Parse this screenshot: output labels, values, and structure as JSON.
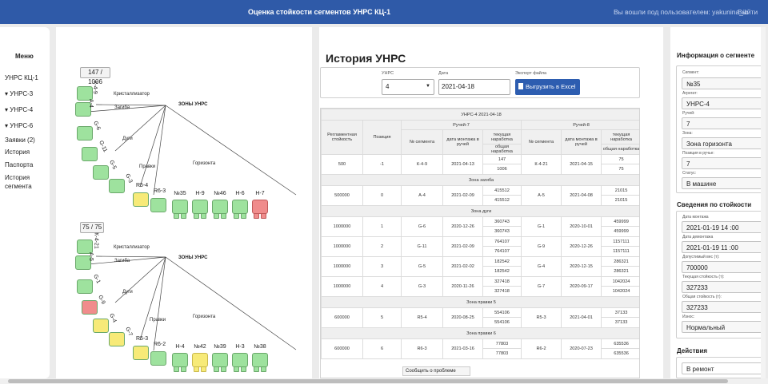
{
  "header": {
    "title": "Оценка стойкости сегментов УНРС КЦ-1",
    "user": "Вы вошли под пользователем: yakunina_ib",
    "logout": "Выйти"
  },
  "menu": {
    "title": "Меню",
    "items": [
      "УНРС КЦ-1",
      "▾ УНРС-3",
      "▾ УНРС-4",
      "▾ УНРС-6",
      "Заявки (2)",
      "История",
      "Паспорта",
      "История",
      "сегмента"
    ]
  },
  "diagram": {
    "top": {
      "counter": "147 / 1006",
      "labels": {
        "crystal": "Кристаллизатор",
        "bend": "Загиба",
        "zones": "ЗОНЫ УНРС",
        "arcs": "Дуги",
        "straight": "Правки",
        "horizon": "Горизонта"
      },
      "arc_segments": [
        {
          "name": "К-4-9",
          "status": "green"
        },
        {
          "name": "А-4",
          "status": "green"
        },
        {
          "name": "G-6",
          "status": "green"
        },
        {
          "name": "G-11",
          "status": "green"
        },
        {
          "name": "G-5",
          "status": "green"
        },
        {
          "name": "G-3",
          "status": "green"
        },
        {
          "name": "R5-4",
          "status": "yellow"
        },
        {
          "name": "R6-3",
          "status": "green"
        }
      ],
      "row_segments": [
        {
          "name": "№35",
          "status": "green"
        },
        {
          "name": "Н-9",
          "status": "green"
        },
        {
          "name": "№46",
          "status": "green"
        },
        {
          "name": "Н-6",
          "status": "green"
        },
        {
          "name": "Н-7",
          "status": "red"
        }
      ]
    },
    "bottom": {
      "counter": "75 / 75",
      "labels": {
        "crystal": "Кристаллизатор",
        "bend": "Загиба",
        "zones": "ЗОНЫ УНРС",
        "arcs": "Дуги",
        "straight": "Правки",
        "horizon": "Горизонта"
      },
      "arc_segments": [
        {
          "name": "К-4-21",
          "status": "green"
        },
        {
          "name": "А-5",
          "status": "green"
        },
        {
          "name": "G-1",
          "status": "green"
        },
        {
          "name": "G-9",
          "status": "red"
        },
        {
          "name": "G-4",
          "status": "yellow"
        },
        {
          "name": "G-7",
          "status": "yellow"
        },
        {
          "name": "R5-3",
          "status": "yellow"
        },
        {
          "name": "R6-2",
          "status": "green"
        }
      ],
      "row_segments": [
        {
          "name": "Н-4",
          "status": "green"
        },
        {
          "name": "№42",
          "status": "yellow"
        },
        {
          "name": "№39",
          "status": "green"
        },
        {
          "name": "Н-3",
          "status": "green"
        },
        {
          "name": "№38",
          "status": "green"
        }
      ]
    }
  },
  "main": {
    "title": "История УНРС",
    "filters": {
      "unrs_label": "УНРС",
      "unrs_value": "4",
      "date_label": "Дата",
      "date_value": "2021-04-18",
      "export_label": "Экспорт файла",
      "export_button": "Выгрузить в Excel"
    },
    "table": {
      "caption": "УНРС-4 2021-04-18",
      "headers": {
        "resist": "Регламентная стойкость",
        "position": "Позиция",
        "ruchey7": "Ручей-7",
        "ruchey8": "Ручей-8",
        "seg": "№ сегмента",
        "date": "дата монтажа в ручей",
        "cur": "текущая наработка",
        "total": "общая наработка"
      },
      "rows": [
        {
          "type": "data",
          "resist": "500",
          "pos": "-1",
          "s7": "К-4-9",
          "d7": "2021-04-13",
          "c7": "147",
          "t7": "1006",
          "s8": "К-4-21",
          "d8": "2021-04-15",
          "c8": "75",
          "t8": "75"
        },
        {
          "type": "zone",
          "label": "Зона загиба"
        },
        {
          "type": "data",
          "resist": "500000",
          "pos": "0",
          "s7": "А-4",
          "d7": "2021-02-09",
          "c7": "415512",
          "t7": "415512",
          "s8": "А-5",
          "d8": "2021-04-08",
          "c8": "21015",
          "t8": "21015"
        },
        {
          "type": "zone",
          "label": "Зона дуги"
        },
        {
          "type": "data",
          "resist": "1000000",
          "pos": "1",
          "s7": "G-6",
          "d7": "2020-12-26",
          "c7": "360743",
          "t7": "360743",
          "s8": "G-1",
          "d8": "2020-10-01",
          "c8": "459999",
          "t8": "459999"
        },
        {
          "type": "data",
          "resist": "1000000",
          "pos": "2",
          "s7": "G-11",
          "d7": "2021-02-09",
          "c7": "764107",
          "t7": "764107",
          "s8": "G-9",
          "d8": "2020-12-26",
          "c8": "1157111",
          "t8": "1157111"
        },
        {
          "type": "data",
          "resist": "1000000",
          "pos": "3",
          "s7": "G-5",
          "d7": "2021-02-02",
          "c7": "182542",
          "t7": "182542",
          "s8": "G-4",
          "d8": "2020-12-15",
          "c8": "286321",
          "t8": "286321"
        },
        {
          "type": "data",
          "resist": "1000000",
          "pos": "4",
          "s7": "G-3",
          "d7": "2020-11-26",
          "c7": "327418",
          "t7": "327418",
          "s8": "G-7",
          "d8": "2020-09-17",
          "c8": "1042024",
          "t8": "1042024"
        },
        {
          "type": "zone",
          "label": "Зона правки 5"
        },
        {
          "type": "data",
          "resist": "600000",
          "pos": "5",
          "s7": "R5-4",
          "d7": "2020-08-25",
          "c7": "554106",
          "t7": "554106",
          "s8": "R5-3",
          "d8": "2021-04-01",
          "c8": "37133",
          "t8": "37133"
        },
        {
          "type": "zone",
          "label": "Зона правки 6"
        },
        {
          "type": "data",
          "resist": "600000",
          "pos": "6",
          "s7": "R6-3",
          "d7": "2021-03-16",
          "c7": "77803",
          "t7": "77803",
          "s8": "R6-2",
          "d8": "2020-07-23",
          "c8": "635536",
          "t8": "635536"
        }
      ]
    },
    "report_button": "Сообщить о проблеме"
  },
  "info": {
    "title": "Информация о сегменте",
    "fields": [
      {
        "label": "Сегмент:",
        "value": "№35"
      },
      {
        "label": "Агрегат:",
        "value": "УНРС-4"
      },
      {
        "label": "Ручей:",
        "value": "7"
      },
      {
        "label": "Зона:",
        "value": "Зона горизонта"
      },
      {
        "label": "Позиция в ручье:",
        "value": "7"
      },
      {
        "label": "Статус:",
        "value": "В машине"
      }
    ],
    "durability_title": "Сведения по стойкости",
    "durability": [
      {
        "label": "Дата монтажа",
        "value": "2021-01-19 14 :00"
      },
      {
        "label": "Дата демонтажа",
        "value": "2021-01-19 11 :00"
      },
      {
        "label": "Допустимый вес (т):",
        "value": "700000"
      },
      {
        "label": "Текущая стойкость (т):",
        "value": "327233"
      },
      {
        "label": "Общая стойкость (т):",
        "value": "327233"
      },
      {
        "label": "Износ:",
        "value": "Нормальный"
      }
    ],
    "actions_title": "Действия",
    "action_value": "В ремонт"
  },
  "colors": {
    "header": "#2f5aa8",
    "green": "#9ee29e",
    "yellow": "#f7ea78",
    "red": "#f08c8c",
    "button": "#2d5db0"
  }
}
